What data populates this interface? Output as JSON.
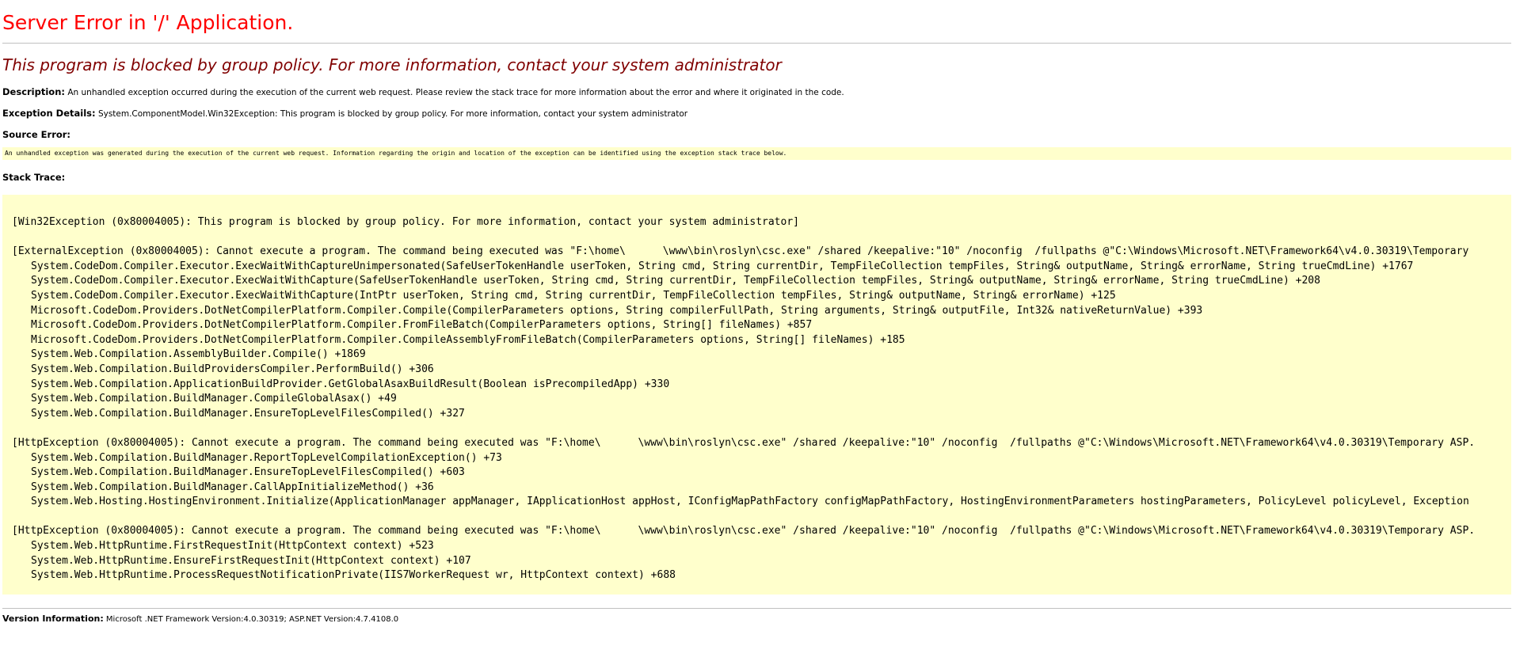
{
  "title": "Server Error in '/' Application.",
  "subtitle": "This program is blocked by group policy. For more information, contact your system administrator",
  "description": {
    "label": "Description:",
    "text": "An unhandled exception occurred during the execution of the current web request. Please review the stack trace for more information about the error and where it originated in the code."
  },
  "exception_details": {
    "label": "Exception Details:",
    "text": "System.ComponentModel.Win32Exception: This program is blocked by group policy. For more information, contact your system administrator"
  },
  "source_error": {
    "label": "Source Error:",
    "text": "An unhandled exception was generated during the execution of the current web request. Information regarding the origin and location of the exception can be identified using the exception stack trace below."
  },
  "stack_trace": {
    "label": "Stack Trace:",
    "blocks": [
      {
        "header": "[Win32Exception (0x80004005): This program is blocked by group policy. For more information, contact your system administrator]",
        "frames": []
      },
      {
        "header": "[ExternalException (0x80004005): Cannot execute a program. The command being executed was \"F:\\home\\      \\www\\bin\\roslyn\\csc.exe\" /shared /keepalive:\"10\" /noconfig  /fullpaths @\"C:\\Windows\\Microsoft.NET\\Framework64\\v4.0.30319\\Temporary",
        "frames": [
          "System.CodeDom.Compiler.Executor.ExecWaitWithCaptureUnimpersonated(SafeUserTokenHandle userToken, String cmd, String currentDir, TempFileCollection tempFiles, String& outputName, String& errorName, String trueCmdLine) +1767",
          "System.CodeDom.Compiler.Executor.ExecWaitWithCapture(SafeUserTokenHandle userToken, String cmd, String currentDir, TempFileCollection tempFiles, String& outputName, String& errorName, String trueCmdLine) +208",
          "System.CodeDom.Compiler.Executor.ExecWaitWithCapture(IntPtr userToken, String cmd, String currentDir, TempFileCollection tempFiles, String& outputName, String& errorName) +125",
          "Microsoft.CodeDom.Providers.DotNetCompilerPlatform.Compiler.Compile(CompilerParameters options, String compilerFullPath, String arguments, String& outputFile, Int32& nativeReturnValue) +393",
          "Microsoft.CodeDom.Providers.DotNetCompilerPlatform.Compiler.FromFileBatch(CompilerParameters options, String[] fileNames) +857",
          "Microsoft.CodeDom.Providers.DotNetCompilerPlatform.Compiler.CompileAssemblyFromFileBatch(CompilerParameters options, String[] fileNames) +185",
          "System.Web.Compilation.AssemblyBuilder.Compile() +1869",
          "System.Web.Compilation.BuildProvidersCompiler.PerformBuild() +306",
          "System.Web.Compilation.ApplicationBuildProvider.GetGlobalAsaxBuildResult(Boolean isPrecompiledApp) +330",
          "System.Web.Compilation.BuildManager.CompileGlobalAsax() +49",
          "System.Web.Compilation.BuildManager.EnsureTopLevelFilesCompiled() +327"
        ]
      },
      {
        "header": "[HttpException (0x80004005): Cannot execute a program. The command being executed was \"F:\\home\\      \\www\\bin\\roslyn\\csc.exe\" /shared /keepalive:\"10\" /noconfig  /fullpaths @\"C:\\Windows\\Microsoft.NET\\Framework64\\v4.0.30319\\Temporary ASP.",
        "frames": [
          "System.Web.Compilation.BuildManager.ReportTopLevelCompilationException() +73",
          "System.Web.Compilation.BuildManager.EnsureTopLevelFilesCompiled() +603",
          "System.Web.Compilation.BuildManager.CallAppInitializeMethod() +36",
          "System.Web.Hosting.HostingEnvironment.Initialize(ApplicationManager appManager, IApplicationHost appHost, IConfigMapPathFactory configMapPathFactory, HostingEnvironmentParameters hostingParameters, PolicyLevel policyLevel, Exception"
        ]
      },
      {
        "header": "[HttpException (0x80004005): Cannot execute a program. The command being executed was \"F:\\home\\      \\www\\bin\\roslyn\\csc.exe\" /shared /keepalive:\"10\" /noconfig  /fullpaths @\"C:\\Windows\\Microsoft.NET\\Framework64\\v4.0.30319\\Temporary ASP.",
        "frames": [
          "System.Web.HttpRuntime.FirstRequestInit(HttpContext context) +523",
          "System.Web.HttpRuntime.EnsureFirstRequestInit(HttpContext context) +107",
          "System.Web.HttpRuntime.ProcessRequestNotificationPrivate(IIS7WorkerRequest wr, HttpContext context) +688"
        ]
      }
    ]
  },
  "version_information": {
    "label": "Version Information:",
    "text": "Microsoft .NET Framework Version:4.0.30319; ASP.NET Version:4.7.4108.0"
  },
  "colors": {
    "title": "#ff0000",
    "subtitle": "#800000",
    "code_background": "#ffffcc"
  }
}
